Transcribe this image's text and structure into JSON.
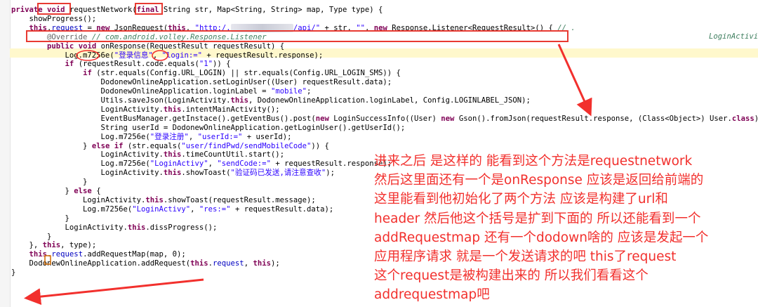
{
  "code_lines": [
    "private void requestNetwork(final String str, Map<String, String> map, Type type) {",
    "    showProgress();",
    "    this.request = new JsonRequest(this, \"http:/.              /api/\" + str, \"\", new Response.Listener<RequestResult>() { // .",
    "        @Override // com.android.volley.Response.Listener",
    "        public void onResponse(RequestResult requestResult) {",
    "            Log.m7256e(\"登录信息\", \"login:=\" + requestResult.response);",
    "            if (requestResult.code.equals(\"1\")) {",
    "                if (str.equals(Config.URL_LOGIN) || str.equals(Config.URL_LOGIN_SMS)) {",
    "                    DodonewOnlineApplication.setLoginUser((User) requestResult.data);",
    "                    DodonewOnlineApplication.loginLabel = \"mobile\";",
    "                    Utils.saveJson(LoginActivity.this, DodonewOnlineApplication.loginLabel, Config.LOGINLABEL_JSON);",
    "                    LoginActivity.this.intentMainActivity();",
    "                    EventBusManager.getInstace().getEventBus().post(new LoginSuccessInfo((User) new Gson().fromJson(requestResult.response, (Class<Object>) User.class)));",
    "                    String userId = DodonewOnlineApplication.getLoginUser().getUserId();",
    "                    Log.m7256e(\"登录注册\", \"userId:=\" + userId);",
    "                } else if (str.equals(\"user/findPwd/sendMobileCode\")) {",
    "                    LoginActivity.this.timeCountUtil.start();",
    "                    Log.m7256e(\"LoginActivy\", \"sendCode:=\" + requestResult.response);",
    "                    LoginActivity.this.showToast(\"验证码已发送,请注意查收\");",
    "                }",
    "            } else {",
    "                LoginActivity.this.showToast(requestResult.message);",
    "                Log.m7256e(\"LoginActivy\", \"res:=\" + requestResult.data);",
    "            }",
    "            LoginActivity.this.dissProgress();",
    "        }",
    "    }, this, type);",
    "    this.request.addRequestMap(map, 0);",
    "    DodonewOnlineApplication.addRequest(this.request, this);",
    "}"
  ],
  "code_right_comment": "LoginActivit",
  "annotation": {
    "lines": [
      "进来之后  是这样的 能看到这个方法是requestnetwork",
      "然后这里面还有一个是onResponse 应该是返回给前端的",
      "这里能看到他初始化了两个方法 应该是构建了url和",
      "header 然后他这个括号是扩到下面的    所以还能看到一个",
      "addRequestmap 还有一个dodown啥的 应该是发起一个",
      "应用程序请求 就是一个发送请求的吧 this了request",
      "这个request是被构建出来的  所以我们看看这个",
      "addrequestmap吧"
    ]
  },
  "colors": {
    "annotation_red": "#f2302d",
    "keyword": "#7f0055",
    "string": "#2a00ff",
    "field": "#0000c0",
    "annotation_code": "#646464"
  }
}
